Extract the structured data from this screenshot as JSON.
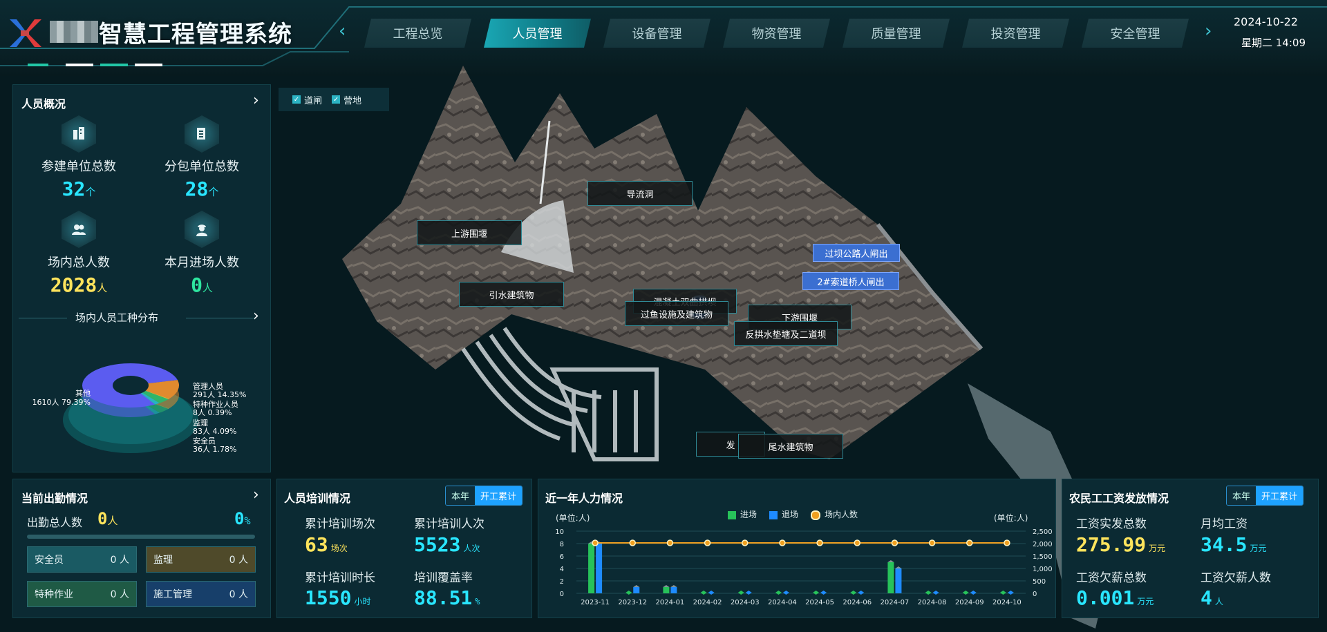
{
  "header": {
    "title": "智慧工程管理系统",
    "date": "2024-10-22",
    "weekday_time": "星期二 14:09",
    "tabs": [
      {
        "label": "工程总览"
      },
      {
        "label": "人员管理"
      },
      {
        "label": "设备管理"
      },
      {
        "label": "物资管理"
      },
      {
        "label": "质量管理"
      },
      {
        "label": "投资管理"
      },
      {
        "label": "安全管理"
      }
    ]
  },
  "overview": {
    "title": "人员概况",
    "stats": [
      {
        "label": "参建单位总数",
        "value": "32",
        "unit": "个",
        "icon": "building-icon"
      },
      {
        "label": "分包单位总数",
        "value": "28",
        "unit": "个",
        "icon": "document-icon"
      },
      {
        "label": "场内总人数",
        "value": "2028",
        "unit": "人",
        "icon": "group-icon"
      },
      {
        "label": "本月进场人数",
        "value": "0",
        "unit": "人",
        "icon": "worker-icon"
      }
    ],
    "distribution_title": "场内人员工种分布",
    "pie": [
      {
        "name": "管理人员",
        "line2": "291人 14.35%",
        "value": 14.35,
        "color": "#e08a2e"
      },
      {
        "name": "特种作业人员",
        "line2": "8人 0.39%",
        "value": 0.39,
        "color": "#d8c23a"
      },
      {
        "name": "监理",
        "line2": "83人 4.09%",
        "value": 4.09,
        "color": "#2fb56a"
      },
      {
        "name": "安全员",
        "line2": "36人 1.78%",
        "value": 1.78,
        "color": "#27b3c2"
      },
      {
        "name": "其他",
        "line2": "1610人 79.39%",
        "value": 79.39,
        "color": "#5b5cf0"
      }
    ]
  },
  "attendance": {
    "title": "当前出勤情况",
    "total_label": "出勤总人数",
    "total_value": "0",
    "total_unit": "人",
    "percent": "0",
    "percent_unit": "%",
    "progress": 0,
    "chips": [
      {
        "label": "安全员",
        "value": "0 人",
        "color": "#1a5a63"
      },
      {
        "label": "监理",
        "value": "0 人",
        "color": "#4f4a2a"
      },
      {
        "label": "特种作业",
        "value": "0 人",
        "color": "#1f5a45"
      },
      {
        "label": "施工管理",
        "value": "0 人",
        "color": "#173f6a"
      }
    ]
  },
  "training": {
    "title": "人员培训情况",
    "toggle": [
      "本年",
      "开工累计"
    ],
    "items": [
      {
        "label": "累计培训场次",
        "value": "63",
        "unit": "场次",
        "color": "#ffe45c"
      },
      {
        "label": "累计培训人次",
        "value": "5523",
        "unit": "人次",
        "color": "#29e6ff"
      },
      {
        "label": "累计培训时长",
        "value": "1550",
        "unit": "小时",
        "color": "#29e6ff"
      },
      {
        "label": "培训覆盖率",
        "value": "88.51",
        "unit": "%",
        "color": "#29e6ff"
      }
    ]
  },
  "manpower": {
    "title": "近一年人力情况",
    "unit_left": "(单位:人)",
    "unit_right": "(单位:人)"
  },
  "wages": {
    "title": "农民工工资发放情况",
    "toggle": [
      "本年",
      "开工累计"
    ],
    "items": [
      {
        "label": "工资实发总数",
        "value": "275.99",
        "unit": "万元",
        "color": "#ffe45c"
      },
      {
        "label": "月均工资",
        "value": "34.5",
        "unit": "万元",
        "color": "#29e6ff"
      },
      {
        "label": "工资欠薪总数",
        "value": "0.001",
        "unit": "万元",
        "color": "#29e6ff"
      },
      {
        "label": "工资欠薪人数",
        "value": "4",
        "unit": "人",
        "color": "#29e6ff"
      }
    ]
  },
  "map": {
    "filters": [
      {
        "label": "道闸",
        "checked": true
      },
      {
        "label": "营地",
        "checked": true
      }
    ],
    "labels": [
      {
        "text": "导流洞"
      },
      {
        "text": "上游围堰"
      },
      {
        "text": "引水建筑物"
      },
      {
        "text": "混凝土双曲拱坝"
      },
      {
        "text": "过鱼设施及建筑物"
      },
      {
        "text": "下游围堰"
      },
      {
        "text": "反拱水垫塘及二道坝"
      },
      {
        "text": "发"
      },
      {
        "text": "尾水建筑物"
      },
      {
        "text": "过坝公路人闸出"
      },
      {
        "text": "2#索道桥人闸出"
      }
    ]
  },
  "chart_data": {
    "type": "bar",
    "title": "近一年人力情况",
    "categories": [
      "2023-11",
      "2023-12",
      "2024-01",
      "2024-02",
      "2024-03",
      "2024-04",
      "2024-05",
      "2024-06",
      "2024-07",
      "2024-08",
      "2024-09",
      "2024-10"
    ],
    "series": [
      {
        "name": "进场",
        "type": "bar",
        "axis": "left",
        "color": "#27c25a",
        "values": [
          8,
          0,
          1,
          0,
          0,
          0,
          0,
          0,
          5,
          0,
          0,
          0
        ]
      },
      {
        "name": "退场",
        "type": "bar",
        "axis": "left",
        "color": "#1e8bff",
        "values": [
          8,
          1,
          1,
          0,
          0,
          0,
          0,
          0,
          4,
          0,
          0,
          0
        ]
      },
      {
        "name": "场内人数",
        "type": "line",
        "axis": "right",
        "color": "#f0a020",
        "values": [
          2028,
          2028,
          2028,
          2028,
          2028,
          2028,
          2028,
          2028,
          2028,
          2028,
          2028,
          2028
        ]
      }
    ],
    "yleft": {
      "ylim": [
        0,
        10
      ],
      "ticks": [
        0,
        2,
        4,
        6,
        8,
        10
      ]
    },
    "yright": {
      "ylim": [
        0,
        2500
      ],
      "ticks": [
        "0",
        "500",
        "1,000",
        "1,500",
        "2,000",
        "2,500"
      ]
    },
    "legend_position": "top-center"
  }
}
